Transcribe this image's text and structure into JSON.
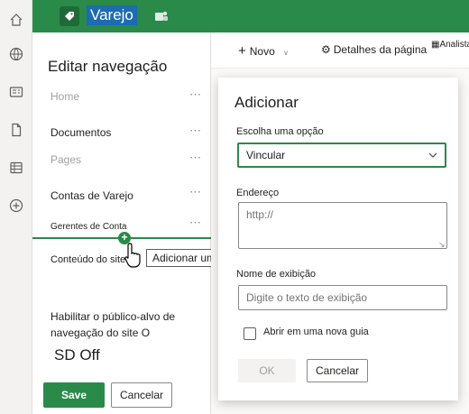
{
  "header": {
    "site_name": "Varejo",
    "brand_color": "#2a8a4a"
  },
  "rail": {
    "icons": [
      "home-icon",
      "globe-icon",
      "news-icon",
      "file-icon",
      "list-icon",
      "add-icon"
    ]
  },
  "nav_panel": {
    "title": "Editar navegação",
    "items": [
      {
        "label": "Home",
        "faded": true
      },
      {
        "label": "Documentos",
        "faded": false
      },
      {
        "label": "Pages",
        "faded": true
      },
      {
        "label": "Contas de Varejo",
        "faded": false
      },
      {
        "label": "Gerentes de Conta",
        "faded": false
      },
      {
        "label": "Conteúdo do site",
        "faded": false
      }
    ],
    "tooltip": "Adicionar um rótulo de link ao",
    "audience_label": "Habilitar o público-alvo de navegação do site O",
    "audience_toggle": "SD Off",
    "save_label": "Save",
    "cancel_label": "Cancelar"
  },
  "command_bar": {
    "new_label": "Novo",
    "page_details_label": "Detalhes da página",
    "analytics_label": "Analista"
  },
  "dialog": {
    "title": "Adicionar",
    "choose_label": "Escolha uma opção",
    "choose_value": "Vincular",
    "address_label": "Endereço",
    "address_placeholder": "http://",
    "display_name_label": "Nome de exibição",
    "display_name_placeholder": "Digite o texto de exibição",
    "new_tab_label": "Abrir em uma nova guia",
    "new_tab_checked": false,
    "ok_label": "OK",
    "cancel_label": "Cancelar"
  }
}
